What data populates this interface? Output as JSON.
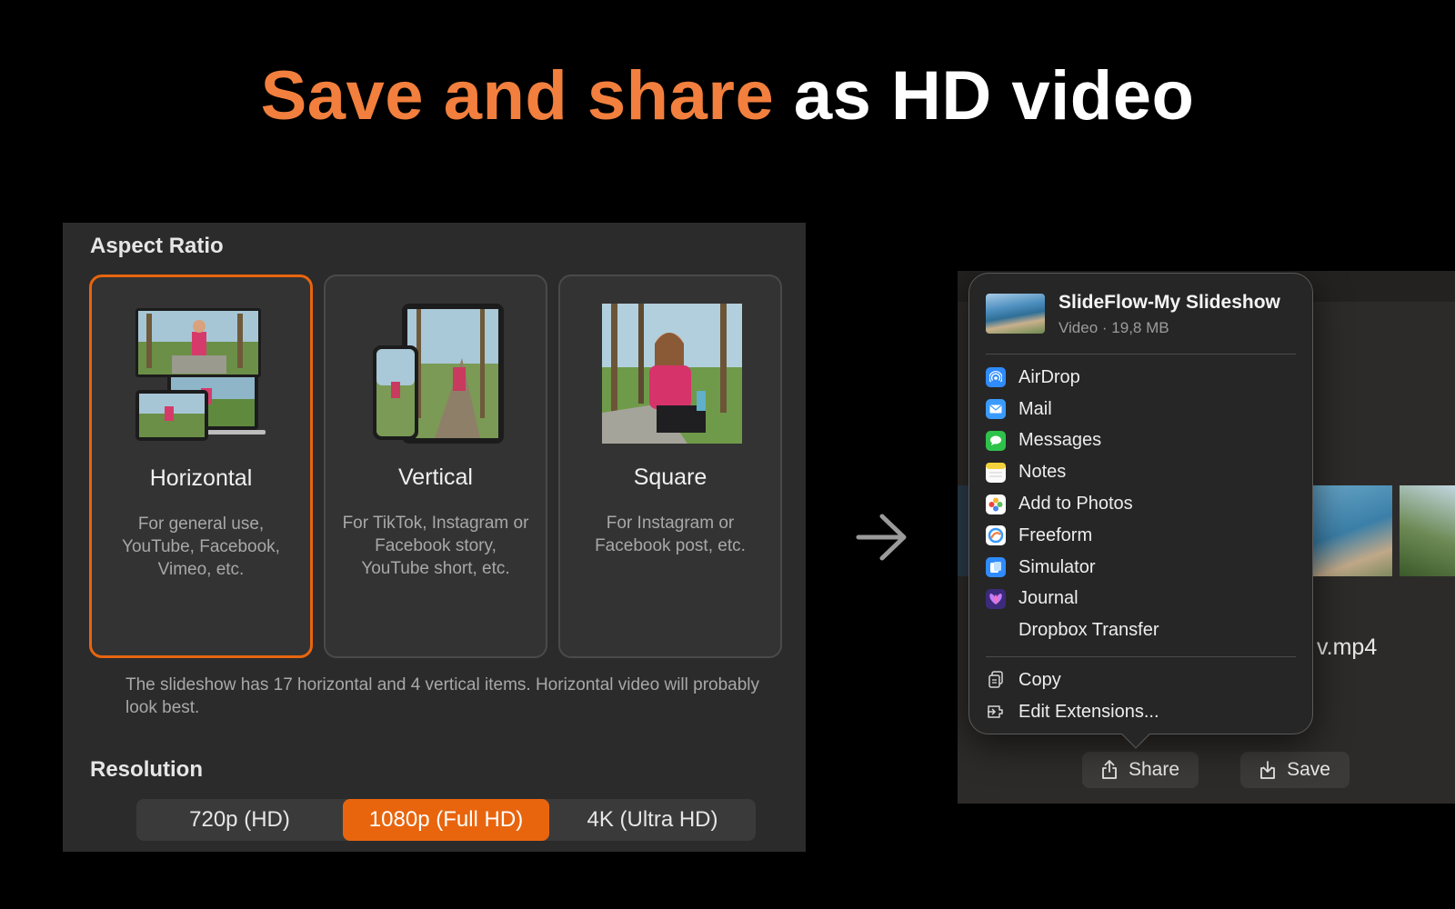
{
  "headline": {
    "accent": "Save and share",
    "rest": "as HD video"
  },
  "aspect": {
    "title": "Aspect Ratio",
    "cards": [
      {
        "name": "Horizontal",
        "desc": "For general use, YouTube, Facebook, Vimeo, etc.",
        "selected": true
      },
      {
        "name": "Vertical",
        "desc": "For TikTok, Instagram or Facebook story, YouTube short, etc.",
        "selected": false
      },
      {
        "name": "Square",
        "desc": "For Instagram or Facebook post, etc.",
        "selected": false
      }
    ],
    "note": "The slideshow has 17 horizontal and 4 vertical items. Horizontal video will probably look best."
  },
  "resolution": {
    "title": "Resolution",
    "options": [
      "720p (HD)",
      "1080p (Full HD)",
      "4K (Ultra HD)"
    ],
    "selected": "1080p (Full HD)"
  },
  "share": {
    "title": "SlideFlow-My Slideshow",
    "subtitle": "Video · 19,8 MB",
    "items": [
      {
        "label": "AirDrop",
        "icon": "airdrop-icon",
        "color": "#2f8cff"
      },
      {
        "label": "Mail",
        "icon": "mail-icon",
        "color": "#3a9bff"
      },
      {
        "label": "Messages",
        "icon": "messages-icon",
        "color": "#2fc24b"
      },
      {
        "label": "Notes",
        "icon": "notes-icon",
        "color": "#f4d23c"
      },
      {
        "label": "Add to Photos",
        "icon": "photos-icon",
        "color": "#ffffff"
      },
      {
        "label": "Freeform",
        "icon": "freeform-icon",
        "color": "#ffffff"
      },
      {
        "label": "Simulator",
        "icon": "simulator-icon",
        "color": "#2f8cff"
      },
      {
        "label": "Journal",
        "icon": "journal-icon",
        "color": "#6a3fd6"
      },
      {
        "label": "Dropbox Transfer",
        "icon": "",
        "color": ""
      }
    ],
    "actions": [
      {
        "label": "Copy",
        "icon": "copy-icon"
      },
      {
        "label": "Edit Extensions...",
        "icon": "extensions-icon"
      }
    ]
  },
  "window": {
    "filename_fragment": "v.mp4",
    "share_label": "Share",
    "save_label": "Save"
  },
  "colors": {
    "accent": "#f27f3d",
    "selection": "#e8650e"
  }
}
